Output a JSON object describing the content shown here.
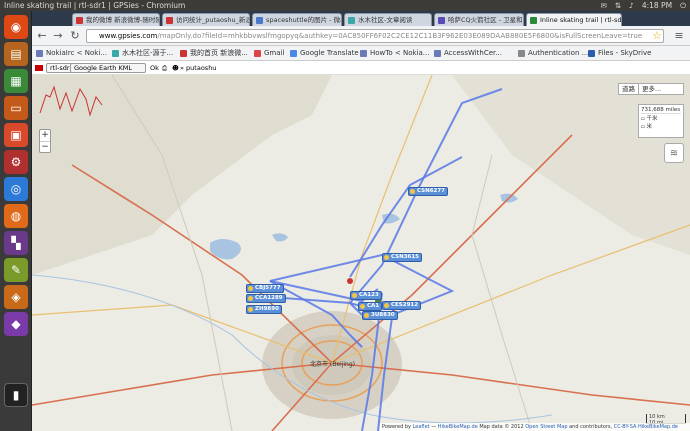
{
  "topbar": {
    "window_title": "Inline skating trail | rtl-sdr1 | GPSies - Chromium",
    "clock": "4:18 PM"
  },
  "launcher": {
    "items": [
      "dash-home",
      "files",
      "libreoffice-calc",
      "libreoffice-impress",
      "system-settings",
      "chromium",
      "firefox",
      "workspaces",
      "text-editor",
      "software-center",
      "purple-app",
      "terminal"
    ]
  },
  "tabs": [
    {
      "label": "我的微博 新浪微博-随时随"
    },
    {
      "label": "访问统计_putaoshu_新浪"
    },
    {
      "label": "spaceshuttle的图片 - 微相"
    },
    {
      "label": "水木社区-文章阅读"
    },
    {
      "label": "哈萨CQ火箭社区 - 卫星和"
    },
    {
      "label": "Inline skating trail | rtl-sdr"
    }
  ],
  "toolbar": {
    "url_host": "www.gpsies.com",
    "url_path": "/mapOnly.do?fileId=mhkbbvwslfmgopyq&authkey=0AC850FF6F02C2CE12C11B3F962E03E089DAAB880E5F6800&isFullScreenLeave=true"
  },
  "bookmarks": [
    {
      "label": "NokiaIrc < Noki..."
    },
    {
      "label": "水木社区-源于..."
    },
    {
      "label": "我的首页 新浪微..."
    },
    {
      "label": "Gmail"
    },
    {
      "label": "Google Translate"
    },
    {
      "label": "HowTo < Nokia..."
    },
    {
      "label": "AccessWithCer..."
    },
    {
      "label": "Authentication ..."
    },
    {
      "label": "Files - SkyDrive"
    }
  ],
  "pagebar": {
    "track_name": "rtl-sdr1",
    "export_format": "Google Earth KML",
    "ok_label": "Ok",
    "user": "putaoshu"
  },
  "map": {
    "maptype_a": "道路",
    "maptype_b": "更多...",
    "distance": "731,688 miles",
    "unit_a": "千米",
    "unit_b": "米",
    "scale_km": "10 km",
    "scale_mi": "10 mi",
    "city_label": "北京市 (Beijing)",
    "waypoints": [
      {
        "label": "CSN6277"
      },
      {
        "label": "CSN3615"
      },
      {
        "label": "CBJ5777"
      },
      {
        "label": "CCA1289"
      },
      {
        "label": "ZH9890"
      },
      {
        "label": "CA123"
      },
      {
        "label": "CES2912"
      },
      {
        "label": "CA1"
      },
      {
        "label": "3U8830"
      }
    ],
    "attribution_powered": "Powered by",
    "attribution_leaflet": "Leaflet",
    "attribution_sep1": " — ",
    "attribution_hikebike": "HikeBikeMap.de",
    "attribution_text": " Map data © 2012 ",
    "attribution_osm": "Open Street Map",
    "attribution_text2": " and contributors, ",
    "attribution_cc": "CC-BY-SA",
    "attribution_end": "HikeBikeMap.de"
  }
}
